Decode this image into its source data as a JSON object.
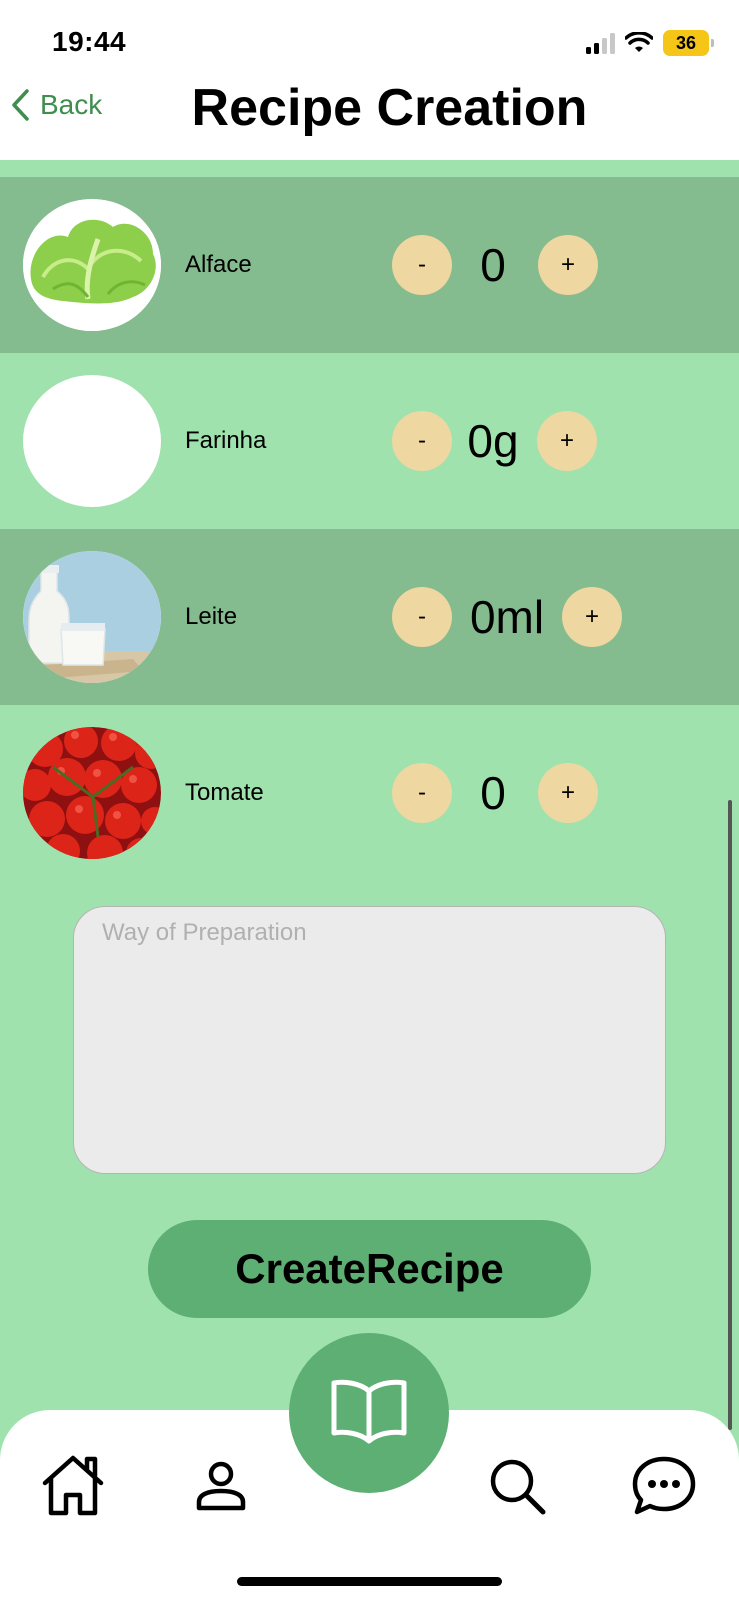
{
  "status_bar": {
    "time": "19:44",
    "battery": "36"
  },
  "header": {
    "back_label": "Back",
    "title": "Recipe Creation"
  },
  "ingredients": [
    {
      "name": "Alface",
      "quantity": "0",
      "minus": "-",
      "plus": "+",
      "image": "lettuce"
    },
    {
      "name": "Farinha",
      "quantity": "0g",
      "minus": "-",
      "plus": "+",
      "image": "empty"
    },
    {
      "name": "Leite",
      "quantity": "0ml",
      "minus": "-",
      "plus": "+",
      "image": "milk"
    },
    {
      "name": "Tomate",
      "quantity": "0",
      "minus": "-",
      "plus": "+",
      "image": "tomatoes"
    }
  ],
  "preparation": {
    "placeholder": "Way of Preparation",
    "value": ""
  },
  "create_button": {
    "label": "CreateRecipe"
  },
  "tabbar": {
    "items": [
      {
        "icon": "home-icon"
      },
      {
        "icon": "profile-icon"
      },
      {
        "icon": "book-icon"
      },
      {
        "icon": "search-icon"
      },
      {
        "icon": "chat-icon"
      }
    ]
  },
  "colors": {
    "background": "#9fe2ae",
    "alt_row": "#84bb8f",
    "stepper": "#eed7a1",
    "accent": "#5daf74",
    "back_link": "#3f8d50"
  }
}
